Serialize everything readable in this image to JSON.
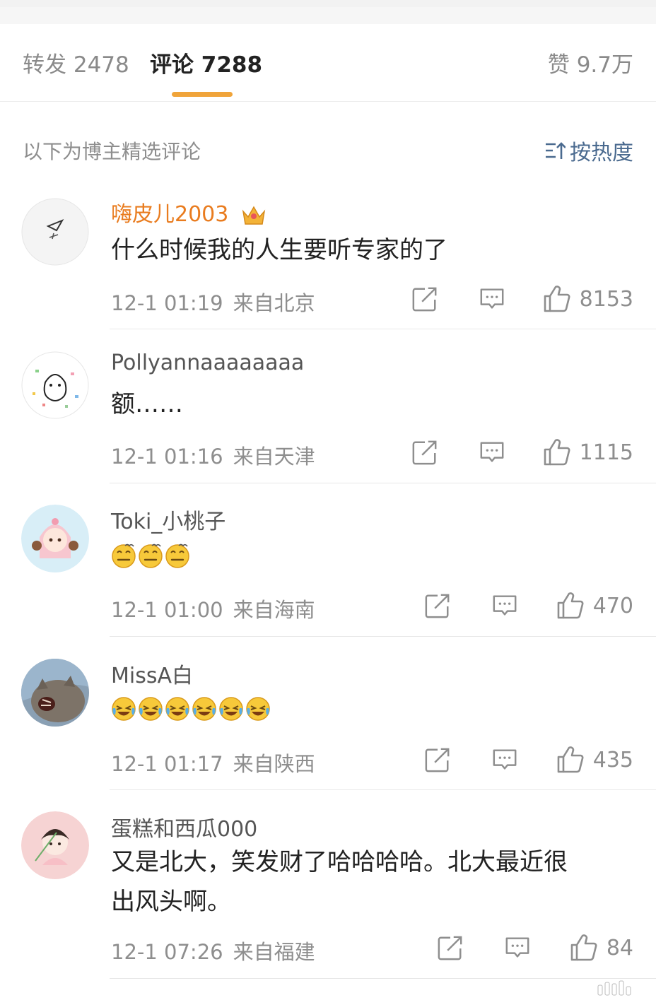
{
  "tabs": {
    "repost": "转发 2478",
    "comment": "评论 7288",
    "like": "赞 9.7万"
  },
  "filter": {
    "label": "以下为博主精选评论",
    "sort": "按热度"
  },
  "comments": [
    {
      "username": "嗨皮儿2003",
      "text": "什么时候我的人生要听专家的了",
      "time": "12-1 01:19",
      "location": "来自北京",
      "likes": "8153"
    },
    {
      "username": "Pollyannaaaaaaaa",
      "text": "额……",
      "time": "12-1 01:16",
      "location": "来自天津",
      "likes": "1115"
    },
    {
      "username": "Toki_小桃子",
      "emoji": "dizzy-face-emoji",
      "emoji_count": 3,
      "time": "12-1 01:00",
      "location": "来自海南",
      "likes": "470"
    },
    {
      "username": "MissA白",
      "emoji": "crying-laughing-emoji",
      "emoji_count": 6,
      "time": "12-1 01:17",
      "location": "来自陕西",
      "likes": "435"
    },
    {
      "username": "蛋糕和西瓜000",
      "text_line1": "又是北大，笑发财了哈哈哈哈。北大最近很",
      "text_line2": "出风头啊。",
      "time": "12-1 07:26",
      "location": "来自福建",
      "likes": "84"
    }
  ],
  "colors": {
    "accent": "#f0a43a",
    "vip_name": "#e97c1f",
    "link_blue": "#4a6a8f",
    "muted": "#8e8e8e"
  }
}
